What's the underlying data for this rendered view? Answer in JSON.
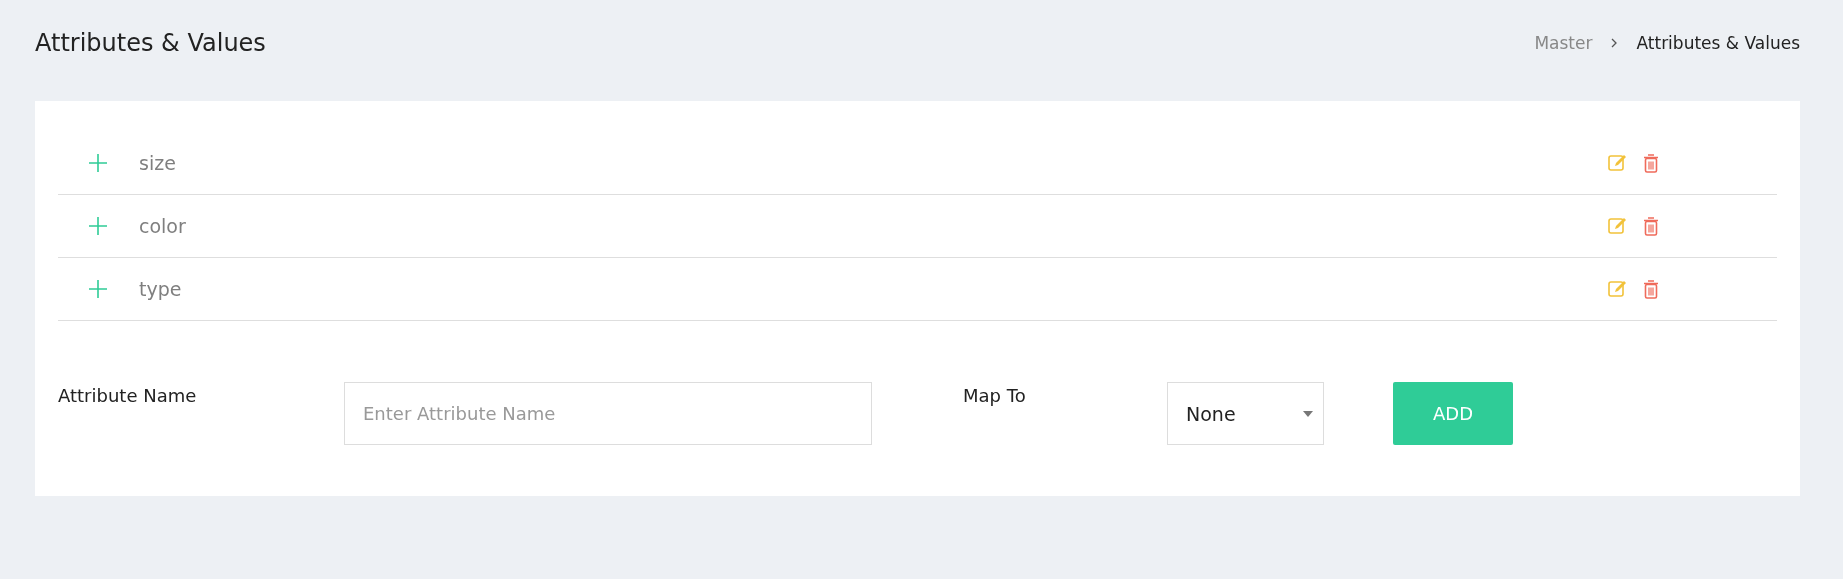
{
  "page_title": "Attributes & Values",
  "breadcrumb": [
    {
      "label": "Master",
      "current": false
    },
    {
      "label": "Attributes & Values",
      "current": true
    }
  ],
  "attributes": [
    {
      "name": "size"
    },
    {
      "name": "color"
    },
    {
      "name": "type"
    }
  ],
  "form": {
    "name_label": "Attribute Name",
    "name_placeholder": "Enter Attribute Name",
    "map_label": "Map To",
    "map_value": "None",
    "button": "ADD"
  }
}
